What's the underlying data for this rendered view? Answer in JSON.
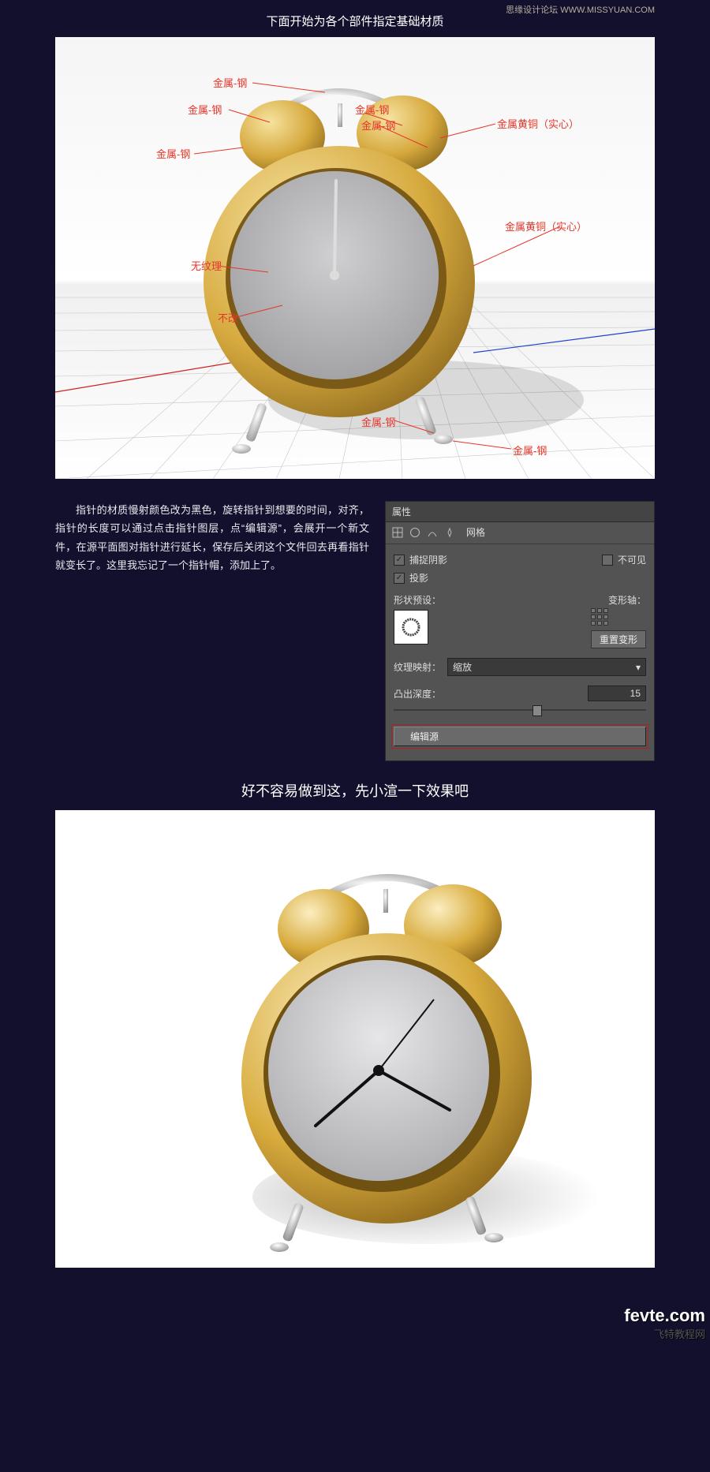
{
  "topnote": "思缘设计论坛  WWW.MISSYUAN.COM",
  "title1": "下面开始为各个部件指定基础材质",
  "callouts": {
    "handle": "金属-钢",
    "handle2": "金属-钢",
    "bell_l": "金属-钢",
    "post_l": "金属-钢",
    "post_r": "金属-钢",
    "brass_top": "金属黄铜（实心）",
    "brass_body": "金属黄铜（实心）",
    "face": "无纹理",
    "hand": "不改",
    "leg_l": "金属-钢",
    "leg_r": "金属-钢"
  },
  "paragraph": "指针的材质慢射颜色改为黑色，旋转指针到想要的时间，对齐，指针的长度可以通过点击指针图层，点“编辑源”，会展开一个新文件，在源平面图对指针进行延长，保存后关闭这个文件回去再看指针就变长了。这里我忘记了一个指针帽，添加上了。",
  "panel": {
    "header": "属性",
    "tab": "网格",
    "chk_shadow": "捕捉阴影",
    "chk_invisible": "不可见",
    "chk_proj": "投影",
    "shape_preset": "形状预设：",
    "deform_axis": "变形轴：",
    "reset_deform": "重置变形",
    "texture_map": "纹理映射：",
    "select_value": "缩放",
    "extrude": "凸出深度：",
    "extrude_value": "15",
    "edit_source": "编辑源"
  },
  "title2": "好不容易做到这，先小渲一下效果吧",
  "footer_brand": "fevte.com",
  "footer_sub": "飞特教程网"
}
